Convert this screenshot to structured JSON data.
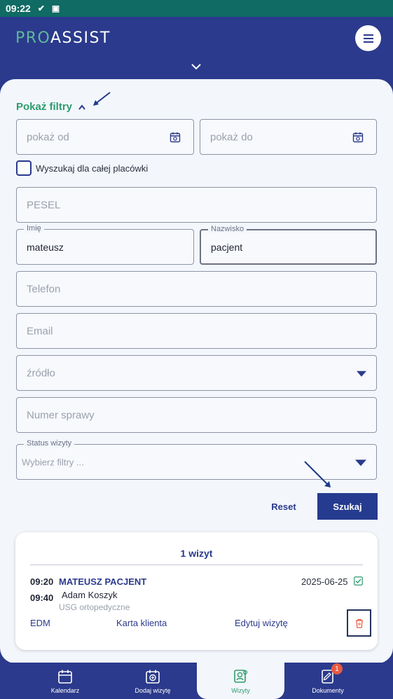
{
  "status_bar": {
    "time": "09:22"
  },
  "header": {
    "logo_text_a": "PRO",
    "logo_text_b": "ASSIST",
    "menu_label": "menu"
  },
  "filters": {
    "toggle_label": "Pokaż filtry",
    "date_from_placeholder": "pokaż od",
    "date_to_placeholder": "pokaż do",
    "whole_facility_label": "Wyszukaj dla całej placówki",
    "pesel_placeholder": "PESEL",
    "first_name_label": "Imię",
    "first_name_value": "mateusz",
    "last_name_label": "Nazwisko",
    "last_name_value": "pacjent",
    "phone_placeholder": "Telefon",
    "email_placeholder": "Email",
    "source_placeholder": "źródło",
    "case_number_placeholder": "Numer sprawy",
    "visit_status_label": "Status wizyty",
    "visit_status_placeholder": "Wybierz filtry ...",
    "reset_label": "Reset",
    "search_label": "Szukaj"
  },
  "results": {
    "count_label": "1 wizyt",
    "visit": {
      "start_time": "09:20",
      "end_time": "09:40",
      "patient_name": "MATEUSZ PACJENT",
      "doctor": "Adam Koszyk",
      "service": "USG ortopedyczne",
      "date": "2025-06-25",
      "actions": {
        "edm": "EDM",
        "client_card": "Karta klienta",
        "edit_visit": "Edytuj wizytę"
      }
    }
  },
  "bottom_nav": {
    "items": [
      {
        "label": "Kalendarz",
        "icon": "calendar-icon"
      },
      {
        "label": "Dodaj wizytę",
        "icon": "calendar-add-icon"
      },
      {
        "label": "Wizyty",
        "icon": "visits-icon"
      },
      {
        "label": "Dokumenty",
        "icon": "documents-icon"
      }
    ],
    "documents_badge": "1"
  },
  "colors": {
    "brand_blue": "#2b3a8c",
    "accent_green": "#2e9c6e",
    "status_bar": "#0f6b64",
    "badge": "#e55a42"
  }
}
